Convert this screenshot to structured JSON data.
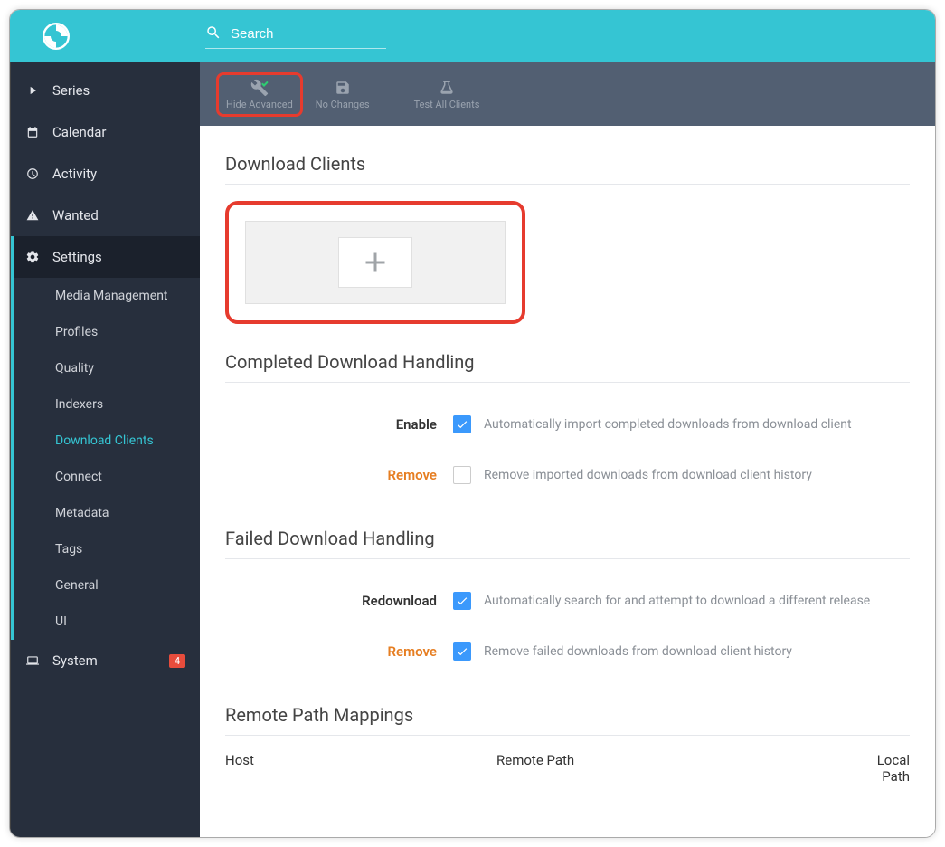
{
  "search": {
    "placeholder": "Search"
  },
  "sidebar": {
    "items": [
      {
        "label": "Series"
      },
      {
        "label": "Calendar"
      },
      {
        "label": "Activity"
      },
      {
        "label": "Wanted"
      },
      {
        "label": "Settings"
      },
      {
        "label": "System",
        "badge": "4"
      }
    ],
    "subitems": [
      {
        "label": "Media Management"
      },
      {
        "label": "Profiles"
      },
      {
        "label": "Quality"
      },
      {
        "label": "Indexers"
      },
      {
        "label": "Download Clients"
      },
      {
        "label": "Connect"
      },
      {
        "label": "Metadata"
      },
      {
        "label": "Tags"
      },
      {
        "label": "General"
      },
      {
        "label": "UI"
      }
    ]
  },
  "toolbar": {
    "hide_advanced": "Hide Advanced",
    "no_changes": "No Changes",
    "test_all": "Test All Clients"
  },
  "sections": {
    "download_clients": "Download Clients",
    "completed": "Completed Download Handling",
    "failed": "Failed Download Handling",
    "remote": "Remote Path Mappings"
  },
  "completed": {
    "enable_label": "Enable",
    "enable_help": "Automatically import completed downloads from download client",
    "remove_label": "Remove",
    "remove_help": "Remove imported downloads from download client history"
  },
  "failed": {
    "redownload_label": "Redownload",
    "redownload_help": "Automatically search for and attempt to download a different release",
    "remove_label": "Remove",
    "remove_help": "Remove failed downloads from download client history"
  },
  "table": {
    "host": "Host",
    "remote_path": "Remote Path",
    "local_path": "Local Path"
  }
}
